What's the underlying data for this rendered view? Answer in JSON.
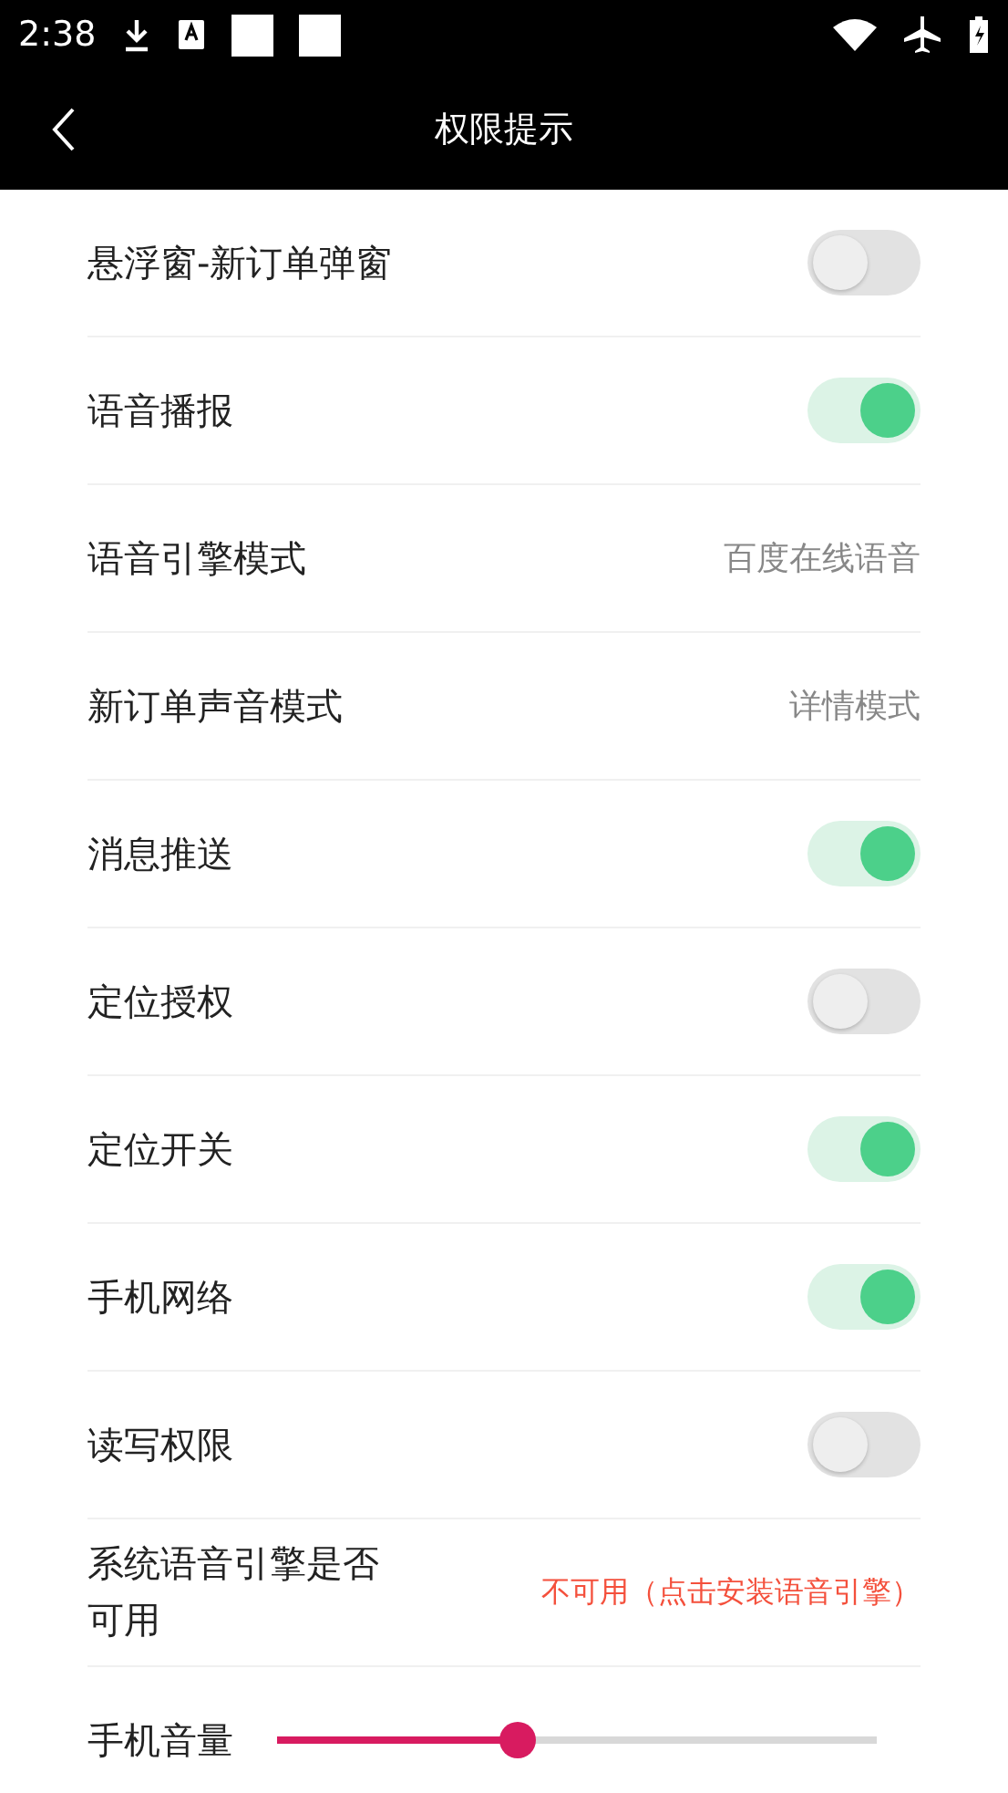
{
  "status_bar": {
    "time": "2:38"
  },
  "header": {
    "title": "权限提示"
  },
  "rows": [
    {
      "kind": "toggle",
      "label": "悬浮窗-新订单弹窗",
      "on": false
    },
    {
      "kind": "toggle",
      "label": "语音播报",
      "on": true
    },
    {
      "kind": "value",
      "label": "语音引擎模式",
      "value": "百度在线语音"
    },
    {
      "kind": "value",
      "label": "新订单声音模式",
      "value": "详情模式"
    },
    {
      "kind": "toggle",
      "label": "消息推送",
      "on": true
    },
    {
      "kind": "toggle",
      "label": "定位授权",
      "on": false
    },
    {
      "kind": "toggle",
      "label": "定位开关",
      "on": true
    },
    {
      "kind": "toggle",
      "label": "手机网络",
      "on": true
    },
    {
      "kind": "toggle",
      "label": "读写权限",
      "on": false
    },
    {
      "kind": "link",
      "label": "系统语音引擎是否可用",
      "value": "不可用（点击安装语音引擎）"
    },
    {
      "kind": "slider",
      "label": "手机音量",
      "level": 0.4
    }
  ]
}
